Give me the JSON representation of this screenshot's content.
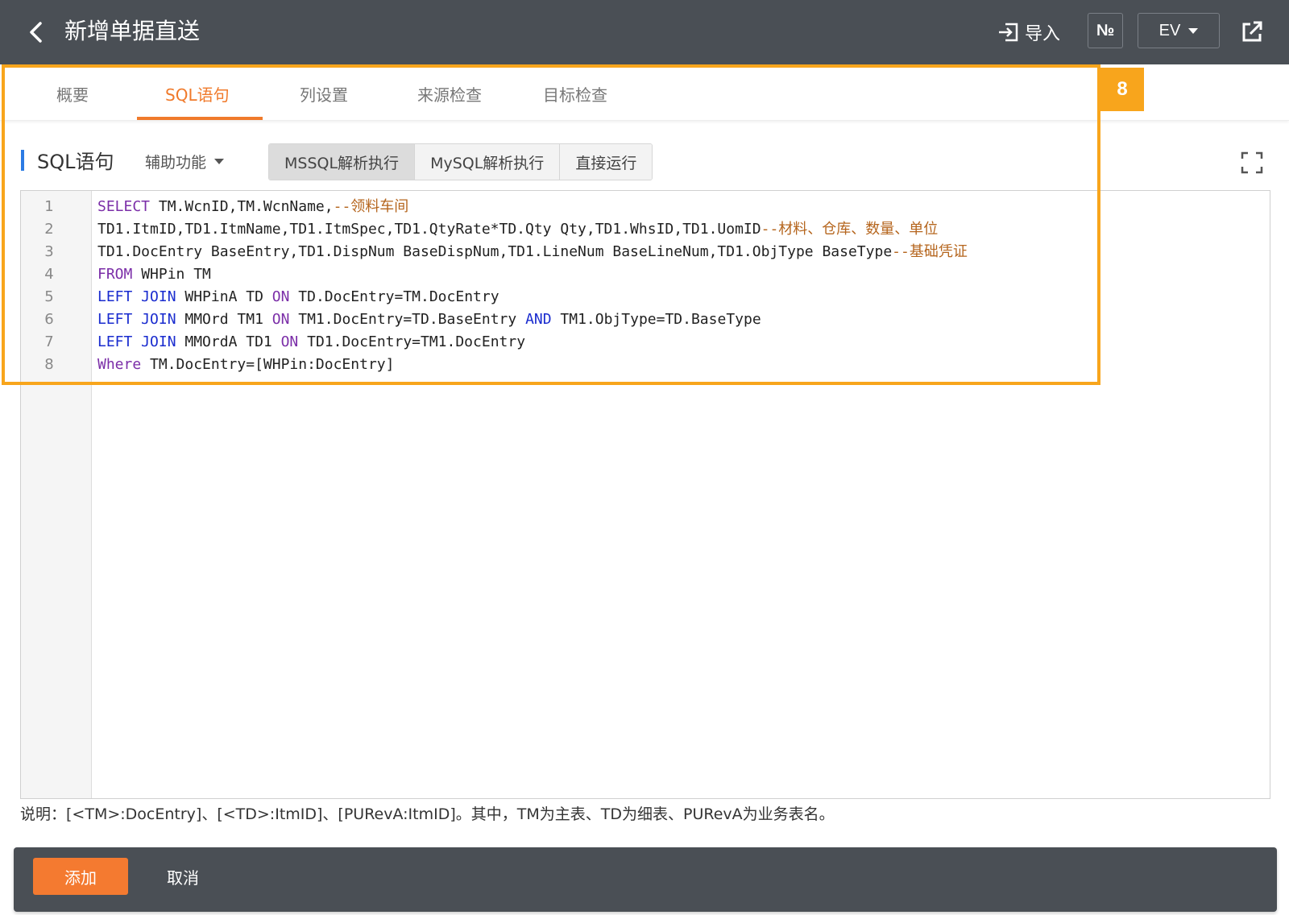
{
  "header": {
    "title": "新增单据直送",
    "import_label": "导入",
    "number_label": "№",
    "ev_label": "EV"
  },
  "tabs": [
    {
      "label": "概要"
    },
    {
      "label": "SQL语句",
      "active": true
    },
    {
      "label": "列设置"
    },
    {
      "label": "来源检查"
    },
    {
      "label": "目标检查"
    }
  ],
  "callout": {
    "number": "8",
    "color": "#f8a51c"
  },
  "toolbar": {
    "section_title": "SQL语句",
    "assist_label": "辅助功能",
    "buttons": [
      "MSSQL解析执行",
      "MySQL解析执行",
      "直接运行"
    ]
  },
  "editor": {
    "line_numbers": [
      "1",
      "2",
      "3",
      "4",
      "5",
      "6",
      "7",
      "8"
    ],
    "lines": [
      [
        {
          "t": "SELECT",
          "c": "kw"
        },
        {
          "t": " TM.WcnID,TM.WcnName,"
        },
        {
          "t": "--领料车间",
          "c": "cm"
        }
      ],
      [
        {
          "t": "TD1.ItmID,TD1.ItmName,TD1.ItmSpec,TD1.QtyRate*TD.Qty Qty,TD1.WhsID,TD1.UomID"
        },
        {
          "t": "--材料、仓库、数量、单位",
          "c": "cm"
        }
      ],
      [
        {
          "t": "TD1.DocEntry BaseEntry,TD1.DispNum BaseDispNum,TD1.LineNum BaseLineNum,TD1.ObjType BaseType"
        },
        {
          "t": "--基础凭证",
          "c": "cm"
        }
      ],
      [
        {
          "t": "FROM",
          "c": "kw"
        },
        {
          "t": " WHPin TM"
        }
      ],
      [
        {
          "t": "LEFT JOIN",
          "c": "kw2"
        },
        {
          "t": " WHPinA TD "
        },
        {
          "t": "ON",
          "c": "kw"
        },
        {
          "t": " TD.DocEntry=TM.DocEntry"
        }
      ],
      [
        {
          "t": "LEFT JOIN",
          "c": "kw2"
        },
        {
          "t": " MMOrd TM1 "
        },
        {
          "t": "ON",
          "c": "kw"
        },
        {
          "t": " TM1.DocEntry=TD.BaseEntry "
        },
        {
          "t": "AND",
          "c": "kw2"
        },
        {
          "t": " TM1.ObjType=TD.BaseType"
        }
      ],
      [
        {
          "t": "LEFT JOIN",
          "c": "kw2"
        },
        {
          "t": " MMOrdA TD1 "
        },
        {
          "t": "ON",
          "c": "kw"
        },
        {
          "t": " TD1.DocEntry=TM1.DocEntry"
        }
      ],
      [
        {
          "t": "Where",
          "c": "kw"
        },
        {
          "t": " TM.DocEntry=[WHPin:DocEntry]"
        }
      ]
    ]
  },
  "note": "说明：[<TM>:DocEntry]、[<TD>:ItmID]、[PURevA:ItmID]。其中，TM为主表、TD为细表、PURevA为业务表名。",
  "footer": {
    "add_label": "添加",
    "cancel_label": "取消"
  },
  "colors": {
    "header_bg": "#4a4f55",
    "accent_orange": "#f07a2b",
    "section_bar_blue": "#2b7be4",
    "keyword_purple": "#7b2ea8",
    "keyword_blue": "#1a2ccf",
    "comment_brown": "#b5651d"
  }
}
